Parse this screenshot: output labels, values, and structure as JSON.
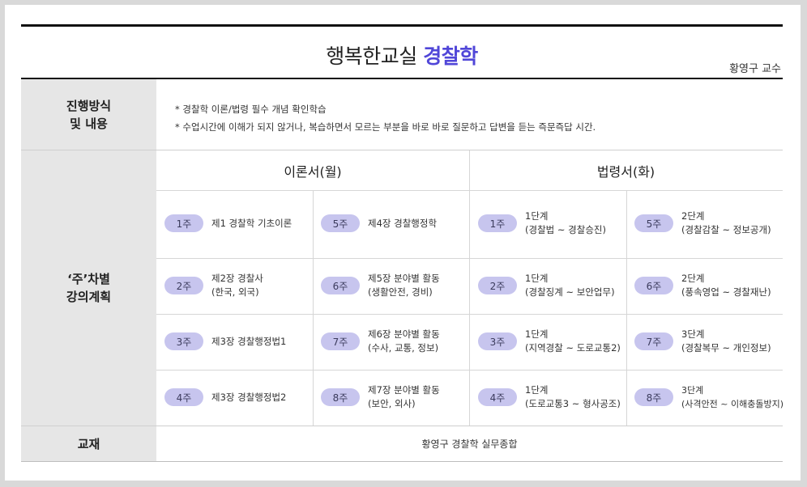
{
  "title": {
    "main": "행복한교실",
    "accent": "경찰학"
  },
  "professor": "황영구 교수",
  "sections": {
    "method_label_line1": "진행방식",
    "method_label_line2": "및 내용",
    "notes": [
      "* 경찰학 이론/법령 필수 개념 확인학습",
      "* 수업시간에 이해가 되지 않거나, 복습하면서 모르는 부분을 바로 바로 질문하고 답변을 듣는 즉문즉답 시간."
    ],
    "plan_label_line1": "‘주’차별",
    "plan_label_line2": "강의계획",
    "textbook_label": "교재",
    "textbook_value": "황영구 경찰학 실무종합"
  },
  "theory": {
    "header": "이론서(월)",
    "weeks": [
      {
        "week": "1주",
        "line1": "제1 경찰학 기초이론",
        "line2": ""
      },
      {
        "week": "2주",
        "line1": "제2장 경찰사",
        "line2": "(한국, 외국)"
      },
      {
        "week": "3주",
        "line1": "제3장 경찰행정법1",
        "line2": ""
      },
      {
        "week": "4주",
        "line1": "제3장 경찰행정법2",
        "line2": ""
      },
      {
        "week": "5주",
        "line1": "제4장 경찰행정학",
        "line2": ""
      },
      {
        "week": "6주",
        "line1": "제5장 분야별 활동",
        "line2": "(생활안전, 경비)"
      },
      {
        "week": "7주",
        "line1": "제6장 분야별 활동",
        "line2": "(수사, 교통, 정보)"
      },
      {
        "week": "8주",
        "line1": "제7장 분야별 활동",
        "line2": "(보안, 외사)"
      }
    ]
  },
  "law": {
    "header": "법령서(화)",
    "weeks": [
      {
        "week": "1주",
        "line1": "1단계",
        "line2": "(경찰법 ~ 경찰승진)"
      },
      {
        "week": "2주",
        "line1": "1단계",
        "line2": "(경찰징계 ~ 보안업무)"
      },
      {
        "week": "3주",
        "line1": "1단계",
        "line2": "(지역경찰 ~ 도로교통2)"
      },
      {
        "week": "4주",
        "line1": "1단계",
        "line2": "(도로교통3 ~ 형사공조)"
      },
      {
        "week": "5주",
        "line1": "2단계",
        "line2": "(경찰감찰 ~ 정보공개)"
      },
      {
        "week": "6주",
        "line1": "2단계",
        "line2": "(풍속영업 ~ 경찰재난)"
      },
      {
        "week": "7주",
        "line1": "3단계",
        "line2": "(경찰복무 ~ 개인정보)"
      },
      {
        "week": "8주",
        "line1": "3단계",
        "line2": "(사격안전 ~ 이해충돌방지)"
      }
    ]
  },
  "colors": {
    "accent": "#5046d8",
    "pill": "#c7c5ee",
    "side_bg": "#e6e6e6"
  }
}
